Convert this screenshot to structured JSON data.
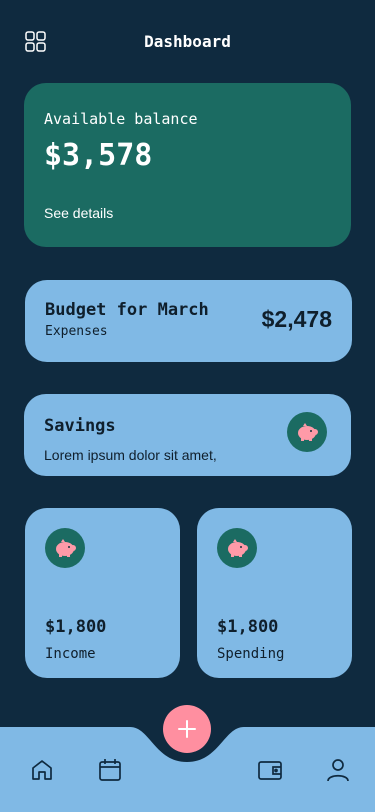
{
  "header": {
    "title": "Dashboard",
    "menu_icon": "grid-icon"
  },
  "balance": {
    "label": "Available balance",
    "amount": "$3,578",
    "details_link": "See details",
    "color": "#1b6b62"
  },
  "budget": {
    "title": "Budget for March",
    "subtitle": "Expenses",
    "amount": "$2,478"
  },
  "savings": {
    "title": "Savings",
    "description": "Lorem ipsum dolor sit amet,",
    "icon": "piggy-bank-icon"
  },
  "income": {
    "amount": "$1,800",
    "label": "Income",
    "icon": "piggy-bank-icon"
  },
  "spending": {
    "amount": "$1,800",
    "label": "Spending",
    "icon": "piggy-bank-icon"
  },
  "nav": {
    "items": [
      "home-icon",
      "calendar-icon",
      "wallet-icon",
      "user-icon"
    ],
    "add_icon": "plus-icon",
    "accent": "#ff8fa0",
    "bar_color": "#80b9e5"
  },
  "colors": {
    "background": "#0f2a3f",
    "card": "#80b9e5",
    "piggy": "#ff9aa8"
  }
}
